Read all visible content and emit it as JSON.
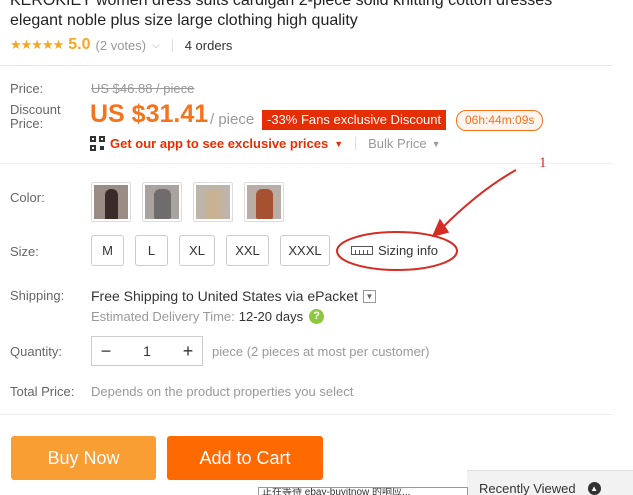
{
  "product": {
    "title_line1": "KEROKIEY women dress suits cardigan 2-piece solid knitting cotton dresses",
    "title_line2": "elegant noble plus size large clothing high quality",
    "stars": "★★★★★",
    "rating": "5.0",
    "votes": "(2 votes)",
    "orders": "4 orders"
  },
  "price": {
    "price_label": "Price:",
    "old_price": "US $46.88 / piece",
    "discount_label_1": "Discount",
    "discount_label_2": "Price:",
    "current_price": "US $31.41",
    "per_piece": "/ piece",
    "promo_badge": "-33% Fans exclusive Discount",
    "timer": "06h:44m:09s",
    "app_link": "Get our app to see exclusive prices",
    "bulk_price": "Bulk Price"
  },
  "options": {
    "color_label": "Color:",
    "size_label": "Size:",
    "sizes": [
      "M",
      "L",
      "XL",
      "XXL",
      "XXXL"
    ],
    "sizing_info": "Sizing info"
  },
  "shipping": {
    "label": "Shipping:",
    "line": "Free Shipping to United States via ePacket",
    "delivery_label": "Estimated Delivery Time:",
    "delivery_days": "12-20 days"
  },
  "quantity": {
    "label": "Quantity:",
    "value": "1",
    "note": "piece (2 pieces at most per customer)"
  },
  "total": {
    "label": "Total Price:",
    "note": "Depends on the product properties you select"
  },
  "actions": {
    "buy_now": "Buy Now",
    "add_to_cart": "Add to Cart"
  },
  "recent": {
    "label": "Recently Viewed"
  },
  "tooltip": {
    "text": "正在等待 ebay-buyitnow 的响应..."
  },
  "annotation": {
    "number": "1"
  },
  "colors": {
    "accent_orange": "#ff6a00",
    "buy_now_bg": "#f89e33",
    "badge_red": "#e62e04",
    "annotation_red": "#d42d24",
    "star_gold": "#f5a623"
  }
}
